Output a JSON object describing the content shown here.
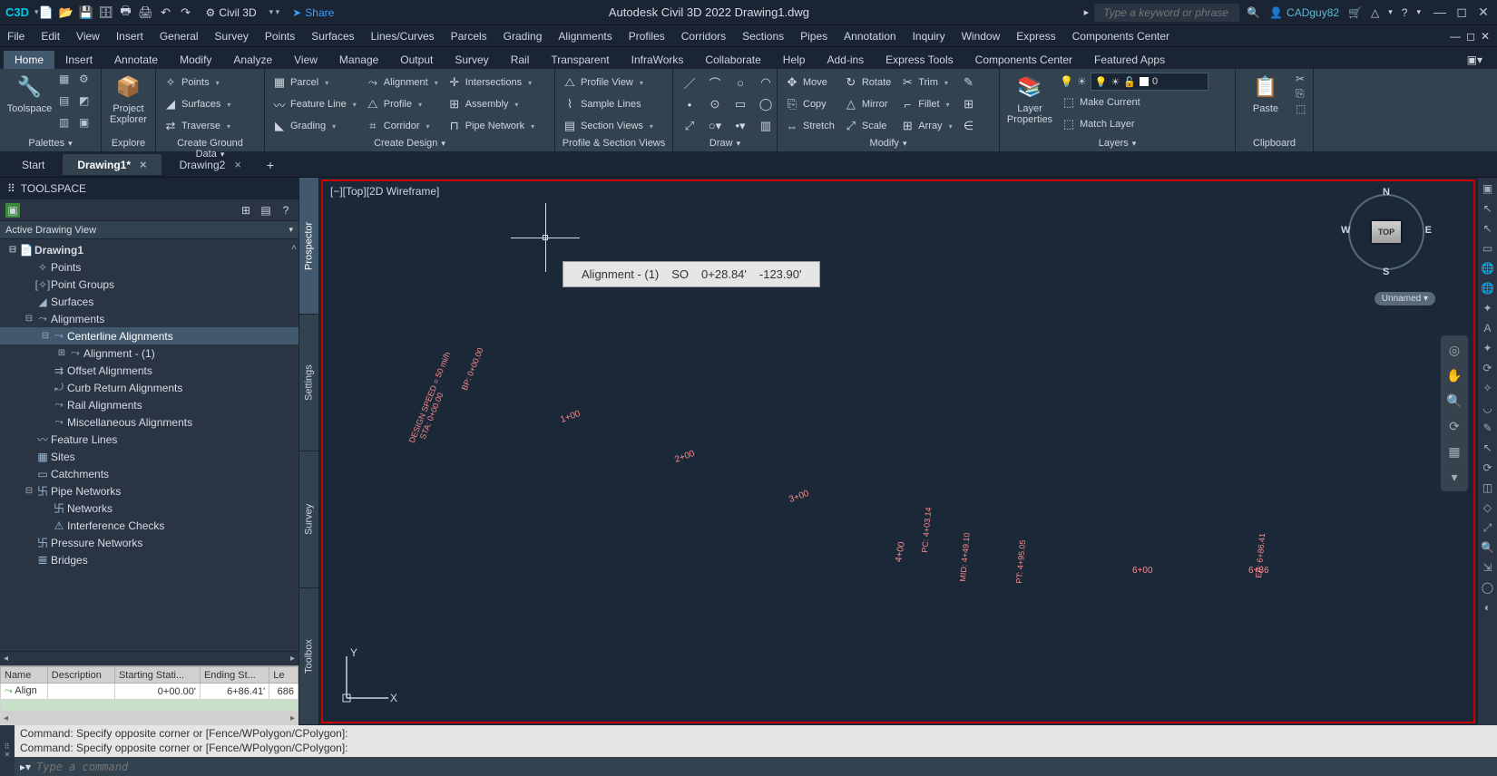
{
  "app": {
    "logo_text": "C3D",
    "workspace": "Civil 3D",
    "share": "Share",
    "title": "Autodesk Civil 3D 2022   Drawing1.dwg",
    "search_placeholder": "Type a keyword or phrase",
    "user": "CADguy82"
  },
  "menubar": [
    "File",
    "Edit",
    "View",
    "Insert",
    "General",
    "Survey",
    "Points",
    "Surfaces",
    "Lines/Curves",
    "Parcels",
    "Grading",
    "Alignments",
    "Profiles",
    "Corridors",
    "Sections",
    "Pipes",
    "Annotation",
    "Inquiry",
    "Window",
    "Express",
    "Components Center"
  ],
  "ribbon_tabs": [
    "Home",
    "Insert",
    "Annotate",
    "Modify",
    "Analyze",
    "View",
    "Manage",
    "Output",
    "Survey",
    "Rail",
    "Transparent",
    "InfraWorks",
    "Collaborate",
    "Help",
    "Add-ins",
    "Express Tools",
    "Components Center",
    "Featured Apps"
  ],
  "panels": {
    "palettes": {
      "title": "Palettes",
      "toolspace": "Toolspace"
    },
    "explore": {
      "title": "Explore",
      "project_explorer": "Project Explorer"
    },
    "ground": {
      "title": "Create Ground Data",
      "points": "Points",
      "surfaces": "Surfaces",
      "traverse": "Traverse"
    },
    "design": {
      "title": "Create Design",
      "parcel": "Parcel",
      "feature_line": "Feature Line",
      "grading": "Grading",
      "alignment": "Alignment",
      "profile": "Profile",
      "corridor": "Corridor",
      "intersections": "Intersections",
      "assembly": "Assembly",
      "pipe_network": "Pipe Network"
    },
    "profile_views": {
      "title": "Profile & Section Views",
      "profile_view": "Profile View",
      "sample_lines": "Sample Lines",
      "section_views": "Section Views"
    },
    "draw": {
      "title": "Draw"
    },
    "modify": {
      "title": "Modify",
      "move": "Move",
      "copy": "Copy",
      "stretch": "Stretch",
      "rotate": "Rotate",
      "mirror": "Mirror",
      "scale": "Scale",
      "trim": "Trim",
      "fillet": "Fillet",
      "array": "Array"
    },
    "layers": {
      "title": "Layers",
      "layer_properties": "Layer Properties",
      "current_layer": "0",
      "make_current": "Make Current",
      "match_layer": "Match Layer"
    },
    "clipboard": {
      "title": "Clipboard",
      "paste": "Paste"
    }
  },
  "doc_tabs": {
    "start": "Start",
    "d1": "Drawing1*",
    "d2": "Drawing2",
    "close": "×",
    "add": "+"
  },
  "toolspace": {
    "title": "TOOLSPACE",
    "view_label": "Active Drawing View",
    "tabs": [
      "Prospector",
      "Settings",
      "Survey",
      "Toolbox"
    ],
    "tree": [
      {
        "depth": 0,
        "exp": "⊟",
        "icon": "📄",
        "label": "Drawing1",
        "bold": true
      },
      {
        "depth": 1,
        "exp": "",
        "icon": "✧",
        "label": "Points"
      },
      {
        "depth": 1,
        "exp": "",
        "icon": "[✧]",
        "label": "Point Groups"
      },
      {
        "depth": 1,
        "exp": "",
        "icon": "◢",
        "label": "Surfaces"
      },
      {
        "depth": 1,
        "exp": "⊟",
        "icon": "⤳",
        "label": "Alignments"
      },
      {
        "depth": 2,
        "exp": "⊟",
        "icon": "⤳",
        "label": "Centerline Alignments",
        "selected": true
      },
      {
        "depth": 3,
        "exp": "⊞",
        "icon": "⤳",
        "label": "Alignment - (1)"
      },
      {
        "depth": 2,
        "exp": "",
        "icon": "⇉",
        "label": "Offset Alignments"
      },
      {
        "depth": 2,
        "exp": "",
        "icon": "⤾",
        "label": "Curb Return Alignments"
      },
      {
        "depth": 2,
        "exp": "",
        "icon": "⤳",
        "label": "Rail Alignments"
      },
      {
        "depth": 2,
        "exp": "",
        "icon": "⤳",
        "label": "Miscellaneous Alignments"
      },
      {
        "depth": 1,
        "exp": "",
        "icon": "〰",
        "label": "Feature Lines"
      },
      {
        "depth": 1,
        "exp": "",
        "icon": "▦",
        "label": "Sites"
      },
      {
        "depth": 1,
        "exp": "",
        "icon": "▭",
        "label": "Catchments"
      },
      {
        "depth": 1,
        "exp": "⊟",
        "icon": "卐",
        "label": "Pipe Networks"
      },
      {
        "depth": 2,
        "exp": "",
        "icon": "卐",
        "label": "Networks"
      },
      {
        "depth": 2,
        "exp": "",
        "icon": "⚠",
        "label": "Interference Checks"
      },
      {
        "depth": 1,
        "exp": "",
        "icon": "卐",
        "label": "Pressure Networks"
      },
      {
        "depth": 1,
        "exp": "",
        "icon": "𝌆",
        "label": "Bridges"
      }
    ],
    "grid": {
      "cols": [
        "Name",
        "Description",
        "Starting Stati...",
        "Ending St...",
        "Le"
      ],
      "row": {
        "name": "Align",
        "desc": "",
        "start": "0+00.00'",
        "end": "6+86.41'",
        "len": "686"
      }
    }
  },
  "viewport": {
    "label": "[−][Top][2D Wireframe]",
    "tooltip": {
      "name": "Alignment - (1)",
      "so": "SO",
      "sta": "0+28.84'",
      "off": "-123.90'"
    },
    "viewcube": {
      "top": "TOP",
      "n": "N",
      "s": "S",
      "e": "E",
      "w": "W",
      "unnamed": "Unnamed ▾"
    },
    "ucs": {
      "x": "X",
      "y": "Y"
    },
    "stations": {
      "s1": "1+00",
      "s2": "2+00",
      "s3": "3+00",
      "s6": "6+00",
      "s686": "6+86",
      "design": "DESIGN SPEED = 50 mi/h",
      "sta0": "STA: 0+00.00",
      "bp": "BP: 0+00.00",
      "vc4": "4+00",
      "mid": "MID: 4+49.10",
      "pt": "PT: 4+95.05",
      "pc": "PC: 4+03.14",
      "ep": "EP: 6+86.41"
    }
  },
  "cmd": {
    "h1": "Command: Specify opposite corner or [Fence/WPolygon/CPolygon]:",
    "h2": "Command: Specify opposite corner or [Fence/WPolygon/CPolygon]:",
    "placeholder": "Type a command",
    "prompt": "▸▾"
  }
}
